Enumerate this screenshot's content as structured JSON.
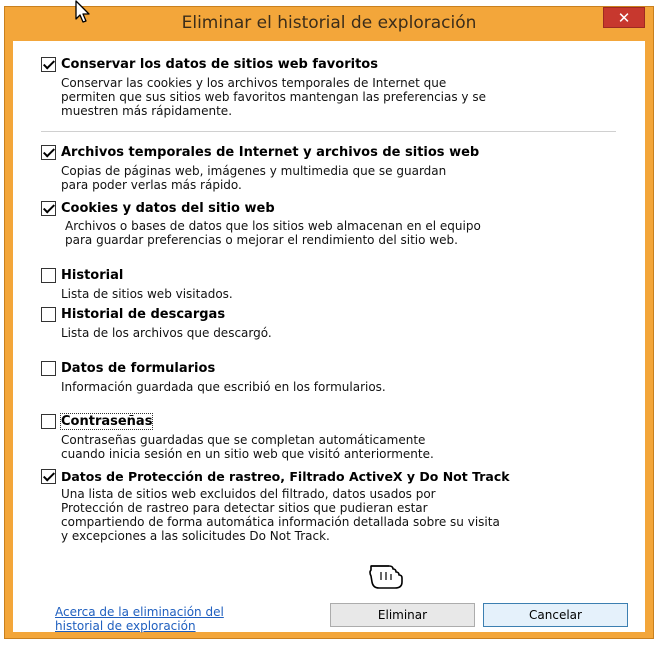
{
  "dialog": {
    "title": "Eliminar el historial de exploración",
    "close_label": "✕"
  },
  "options": [
    {
      "label": "Conservar los datos de sitios web favoritos",
      "checked": true,
      "description": "Conservar las cookies y los archivos temporales de Internet que\npermiten que sus sitios web favoritos mantengan las preferencias y se\nmuestren más rápidamente."
    },
    {
      "label": "Archivos temporales de Internet y archivos de sitios web",
      "checked": true,
      "description": "Copias de páginas web, imágenes y multimedia que se guardan\npara poder verlas más rápido."
    },
    {
      "label": "Cookies y datos del sitio web",
      "checked": true,
      "description": "Archivos o bases de datos que los sitios web almacenan en el equipo\npara guardar preferencias o mejorar el rendimiento del sitio web."
    },
    {
      "label": "Historial",
      "checked": false,
      "description": "Lista de sitios web visitados."
    },
    {
      "label": "Historial de descargas",
      "checked": false,
      "description": "Lista de los archivos que descargó."
    },
    {
      "label": "Datos de formularios",
      "checked": false,
      "description": "Información guardada que escribió en los formularios."
    },
    {
      "label": "Contraseñas",
      "checked": false,
      "description": "Contraseñas guardadas que se completan automáticamente\ncuando inicia sesión en un sitio web que visitó anteriormente."
    },
    {
      "label": "Datos de Protección de rastreo, Filtrado ActiveX y Do Not Track",
      "checked": true,
      "description": "Una lista de sitios web excluidos del filtrado, datos usados por\nProtección de rastreo para detectar sitios que pudieran estar\ncompartiendo de forma automática información detallada sobre su visita\ny excepciones a las solicitudes Do Not Track."
    }
  ],
  "footer": {
    "about_link": "Acerca de la eliminación del\nhistorial de exploración",
    "delete_label": "Eliminar",
    "cancel_label": "Cancelar"
  }
}
